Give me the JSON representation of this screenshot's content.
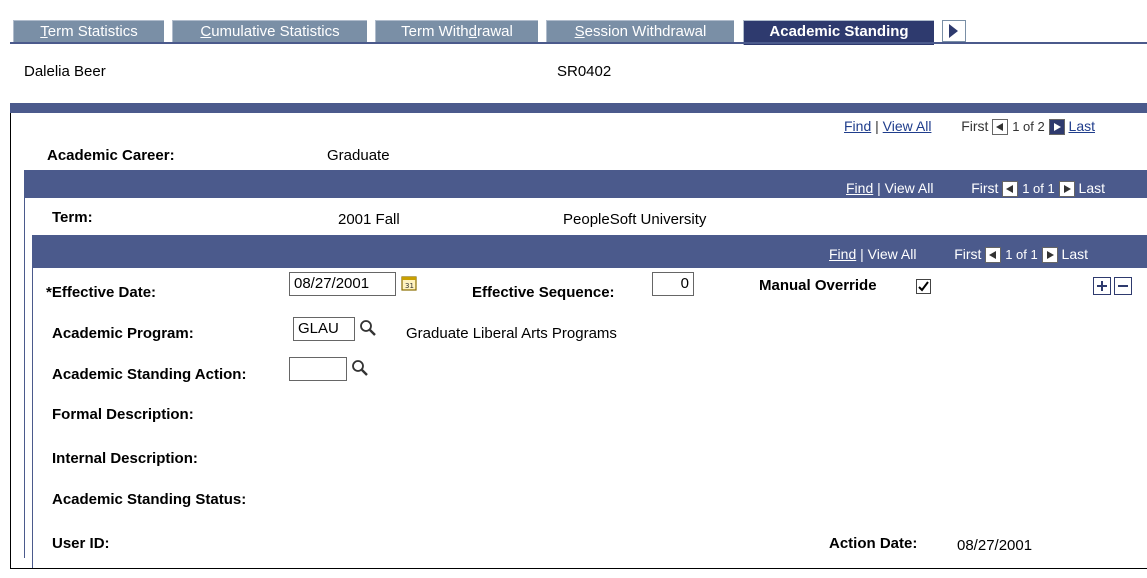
{
  "tabs": [
    {
      "label": "Term Statistics",
      "accel": "T",
      "rest": "erm Statistics"
    },
    {
      "label": "Cumulative Statistics",
      "accel": "C",
      "rest": "umulative Statistics"
    },
    {
      "pre": "Term With",
      "accel": "d",
      "rest": "rawal",
      "label": "Term Withdrawal"
    },
    {
      "label": "Session Withdrawal",
      "accel": "S",
      "rest": "ession Withdrawal"
    },
    {
      "label": "Academic Standing"
    }
  ],
  "student": {
    "name": "Dalelia Beer",
    "id": "SR0402"
  },
  "nav": {
    "find": "Find",
    "view_all": "View All",
    "first": "First",
    "last": "Last",
    "sep": "|",
    "career_count": "1 of 2",
    "term_count": "1 of 1",
    "row_count": "1 of 1"
  },
  "career": {
    "label": "Academic Career:",
    "value": "Graduate"
  },
  "term": {
    "label": "Term:",
    "value": "2001 Fall",
    "institution": "PeopleSoft University"
  },
  "form": {
    "effective_date_label": "*Effective Date:",
    "effective_date": "08/27/2001",
    "effective_sequence_label": "Effective Sequence:",
    "effective_sequence": "0",
    "manual_override_label": "Manual Override",
    "manual_override_checked": true,
    "academic_program_label": "Academic Program:",
    "academic_program": "GLAU",
    "academic_program_desc": "Graduate Liberal Arts Programs",
    "standing_action_label": "Academic Standing Action:",
    "standing_action": "",
    "formal_desc_label": "Formal Description:",
    "internal_desc_label": "Internal Description:",
    "standing_status_label": "Academic Standing Status:",
    "user_id_label": "User ID:",
    "action_date_label": "Action Date:",
    "action_date": "08/27/2001"
  },
  "colors": {
    "band": "#4b5a8c",
    "tab": "#7a8fa6",
    "tab_active": "#2e3a6e",
    "link": "#1f3d8c"
  }
}
